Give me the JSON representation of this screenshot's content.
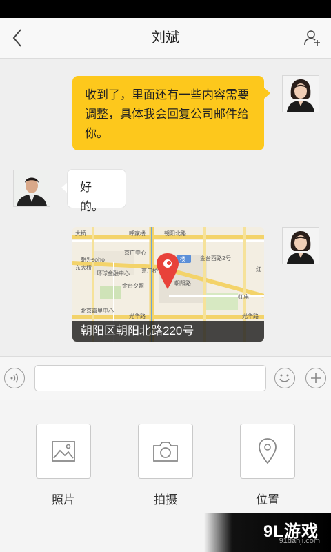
{
  "header": {
    "title": "刘斌"
  },
  "messages": [
    {
      "side": "right",
      "type": "text",
      "text": "收到了，里面还有一些内容需要调整，具体我会回复公司邮件给你。"
    },
    {
      "side": "left",
      "type": "text",
      "text": "好的。"
    },
    {
      "side": "right",
      "type": "location",
      "address": "朝阳区朝阳北路220号"
    }
  ],
  "map": {
    "labels": [
      "大桥",
      "呼家楼",
      "朝阳北路",
      "东大桥",
      "京广中心",
      "金台西路2号",
      "朝外soho",
      "环球金融中心",
      "金台夕照",
      "京广桥",
      "朝阳路",
      "北京嘉里中心",
      "光华路",
      "红庙",
      "光华路",
      "楼",
      "红"
    ]
  },
  "composer": {
    "input_value": "",
    "input_placeholder": ""
  },
  "tools": [
    {
      "label": "照片",
      "icon": "image-icon"
    },
    {
      "label": "拍摄",
      "icon": "camera-icon"
    },
    {
      "label": "位置",
      "icon": "location-pin-icon"
    }
  ],
  "watermark": {
    "brand": "9L游戏",
    "url": "91danji.com"
  },
  "colors": {
    "bubble_self": "#fdc81c",
    "map_pin": "#e8423a"
  }
}
